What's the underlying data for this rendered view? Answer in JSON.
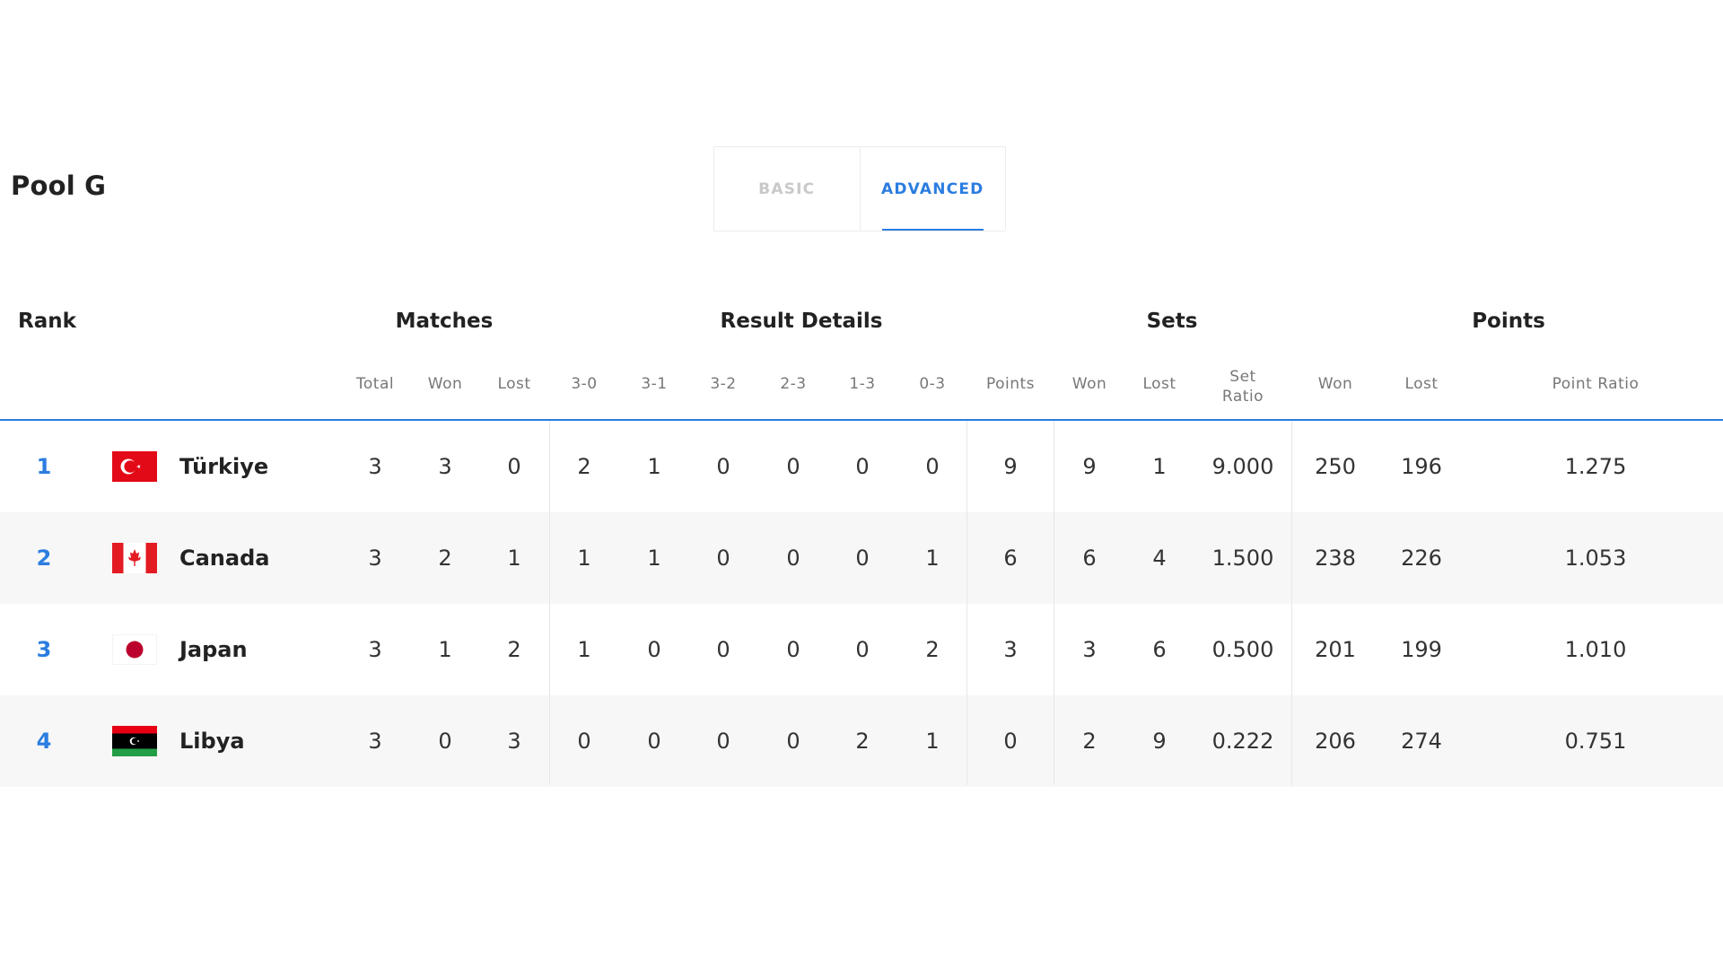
{
  "pool_title": "Pool G",
  "tabs": {
    "basic": "BASIC",
    "advanced": "ADVANCED",
    "active": "advanced"
  },
  "groups": {
    "rank": "Rank",
    "matches": "Matches",
    "result_details": "Result Details",
    "sets": "Sets",
    "points": "Points"
  },
  "columns": {
    "total": "Total",
    "won": "Won",
    "lost": "Lost",
    "r30": "3-0",
    "r31": "3-1",
    "r32": "3-2",
    "r23": "2-3",
    "r13": "1-3",
    "r03": "0-3",
    "points": "Points",
    "sets_won": "Won",
    "sets_lost": "Lost",
    "set_ratio_1": "Set",
    "set_ratio_2": "Ratio",
    "pts_won": "Won",
    "pts_lost": "Lost",
    "point_ratio": "Point Ratio"
  },
  "accent_color": "#2b7de0",
  "rows": [
    {
      "rank": "1",
      "team": "Türkiye",
      "flag": "turkey-flag-icon",
      "total": "3",
      "won": "3",
      "lost": "0",
      "r30": "2",
      "r31": "1",
      "r32": "0",
      "r23": "0",
      "r13": "0",
      "r03": "0",
      "points": "9",
      "sets_won": "9",
      "sets_lost": "1",
      "set_ratio": "9.000",
      "pts_won": "250",
      "pts_lost": "196",
      "point_ratio": "1.275"
    },
    {
      "rank": "2",
      "team": "Canada",
      "flag": "canada-flag-icon",
      "total": "3",
      "won": "2",
      "lost": "1",
      "r30": "1",
      "r31": "1",
      "r32": "0",
      "r23": "0",
      "r13": "0",
      "r03": "1",
      "points": "6",
      "sets_won": "6",
      "sets_lost": "4",
      "set_ratio": "1.500",
      "pts_won": "238",
      "pts_lost": "226",
      "point_ratio": "1.053"
    },
    {
      "rank": "3",
      "team": "Japan",
      "flag": "japan-flag-icon",
      "total": "3",
      "won": "1",
      "lost": "2",
      "r30": "1",
      "r31": "0",
      "r32": "0",
      "r23": "0",
      "r13": "0",
      "r03": "2",
      "points": "3",
      "sets_won": "3",
      "sets_lost": "6",
      "set_ratio": "0.500",
      "pts_won": "201",
      "pts_lost": "199",
      "point_ratio": "1.010"
    },
    {
      "rank": "4",
      "team": "Libya",
      "flag": "libya-flag-icon",
      "total": "3",
      "won": "0",
      "lost": "3",
      "r30": "0",
      "r31": "0",
      "r32": "0",
      "r23": "0",
      "r13": "2",
      "r03": "1",
      "points": "0",
      "sets_won": "2",
      "sets_lost": "9",
      "set_ratio": "0.222",
      "pts_won": "206",
      "pts_lost": "274",
      "point_ratio": "0.751"
    }
  ]
}
